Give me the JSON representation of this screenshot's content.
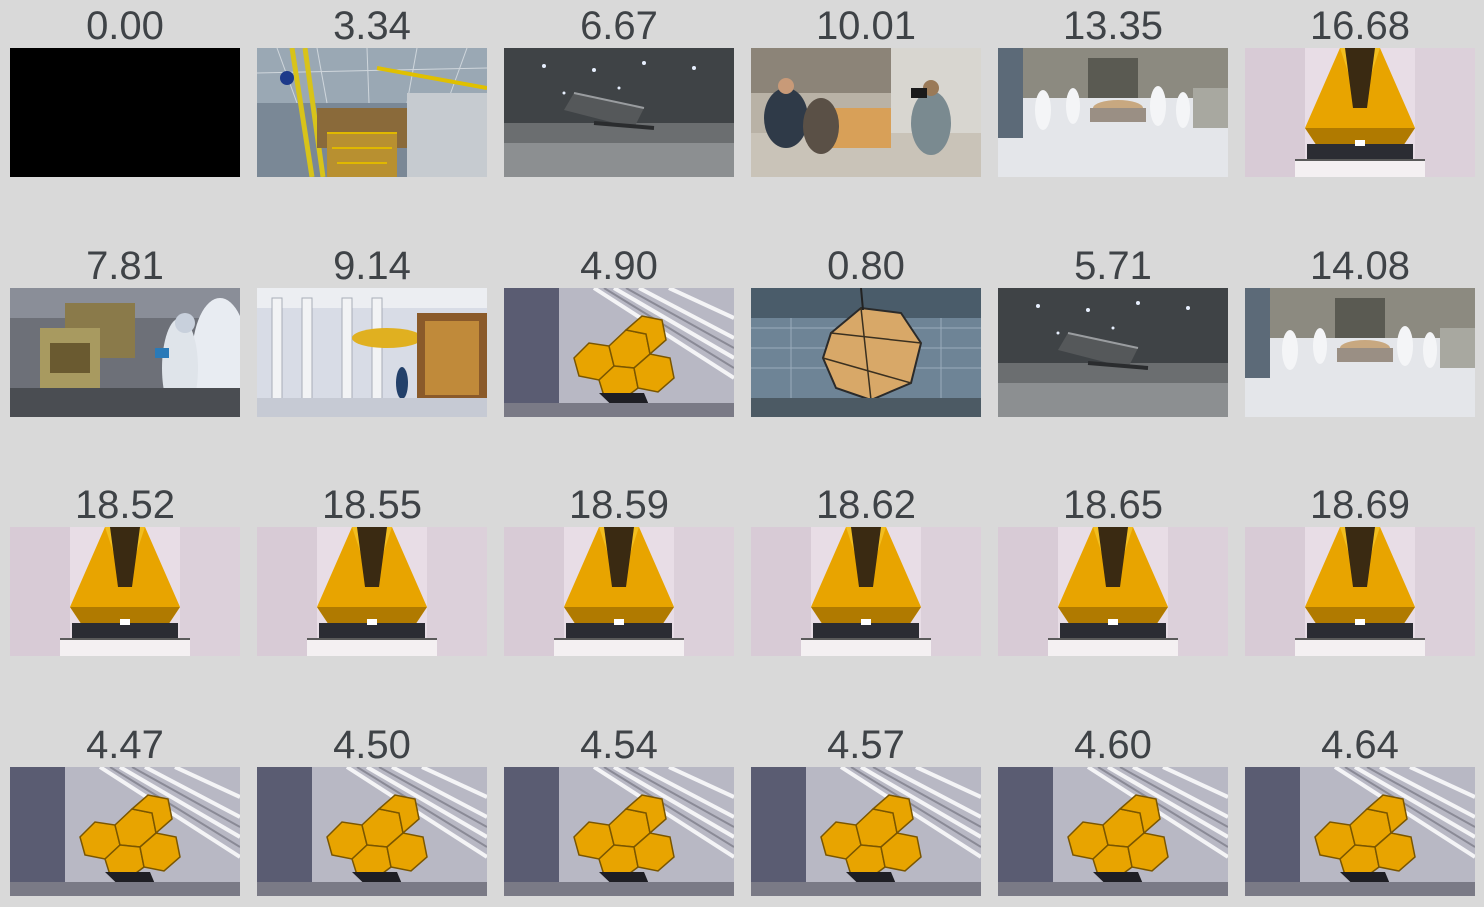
{
  "frames": [
    {
      "time": "0.00",
      "scene": "black"
    },
    {
      "time": "3.34",
      "scene": "hangar-structure"
    },
    {
      "time": "6.67",
      "scene": "dark-chamber"
    },
    {
      "time": "10.01",
      "scene": "workers-crate"
    },
    {
      "time": "13.35",
      "scene": "cleanroom-cart"
    },
    {
      "time": "16.68",
      "scene": "telescope-front"
    },
    {
      "time": "7.81",
      "scene": "instrument-assembly"
    },
    {
      "time": "9.14",
      "scene": "mirror-lift"
    },
    {
      "time": "4.90",
      "scene": "telescope-angled"
    },
    {
      "time": "0.80",
      "scene": "mirror-chamber"
    },
    {
      "time": "5.71",
      "scene": "dark-chamber"
    },
    {
      "time": "14.08",
      "scene": "cleanroom-cart"
    },
    {
      "time": "18.52",
      "scene": "telescope-front"
    },
    {
      "time": "18.55",
      "scene": "telescope-front"
    },
    {
      "time": "18.59",
      "scene": "telescope-front"
    },
    {
      "time": "18.62",
      "scene": "telescope-front"
    },
    {
      "time": "18.65",
      "scene": "telescope-front"
    },
    {
      "time": "18.69",
      "scene": "telescope-front"
    },
    {
      "time": "4.47",
      "scene": "telescope-angled"
    },
    {
      "time": "4.50",
      "scene": "telescope-angled"
    },
    {
      "time": "4.54",
      "scene": "telescope-angled"
    },
    {
      "time": "4.57",
      "scene": "telescope-angled"
    },
    {
      "time": "4.60",
      "scene": "telescope-angled"
    },
    {
      "time": "4.64",
      "scene": "telescope-angled"
    }
  ],
  "colors": {
    "background": "#d9d9d9",
    "label": "#3f4347",
    "mirror_gold": "#e8a400"
  }
}
